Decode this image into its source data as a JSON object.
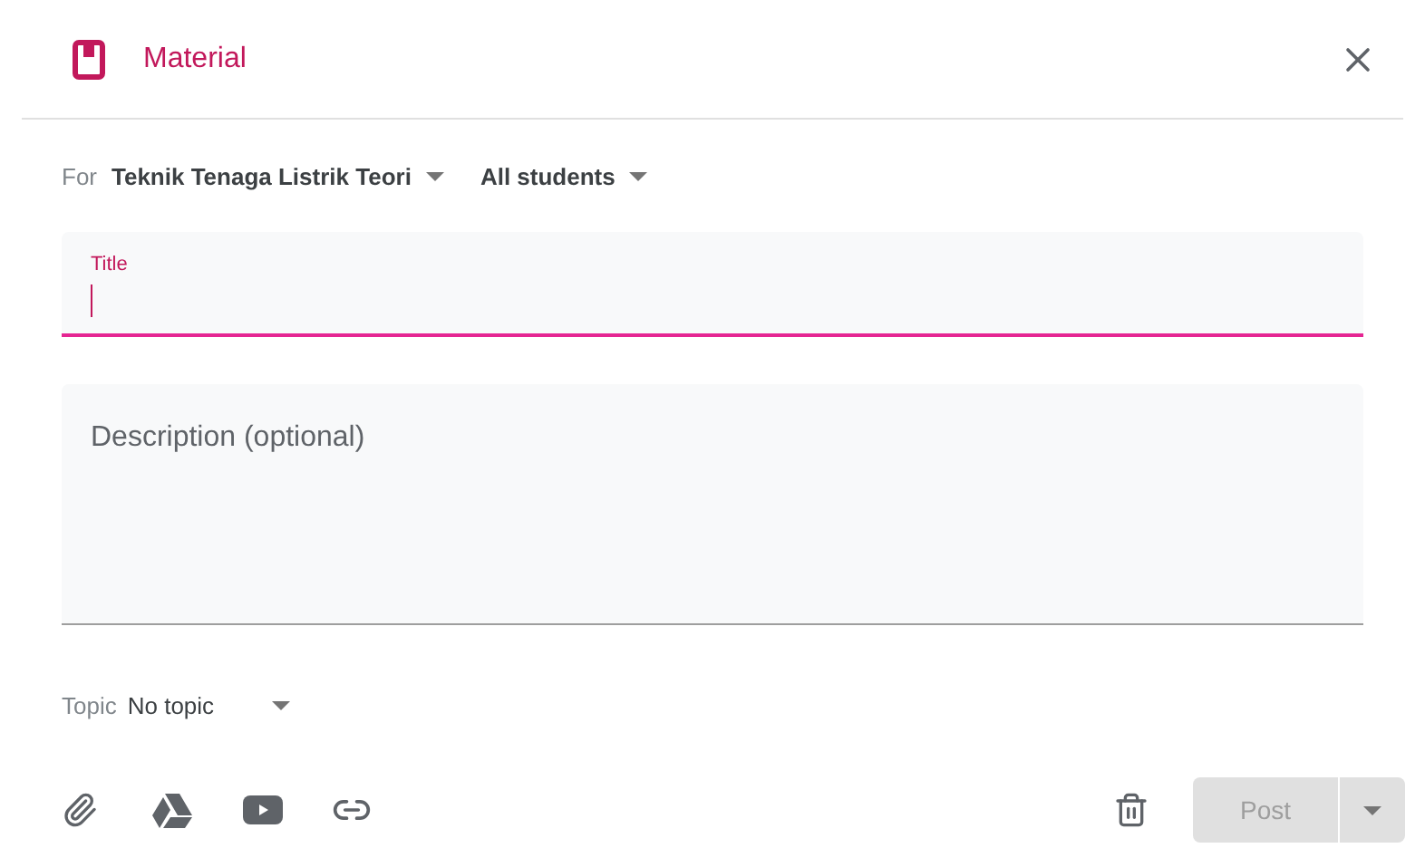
{
  "header": {
    "title": "Material"
  },
  "for_row": {
    "label": "For",
    "class": "Teknik Tenaga Listrik Teori",
    "students": "All students"
  },
  "title_field": {
    "label": "Title",
    "focused": true
  },
  "description_field": {
    "placeholder": "Description (optional)"
  },
  "topic": {
    "label": "Topic",
    "value": "No topic"
  },
  "post_button": {
    "label": "Post",
    "disabled": true
  }
}
